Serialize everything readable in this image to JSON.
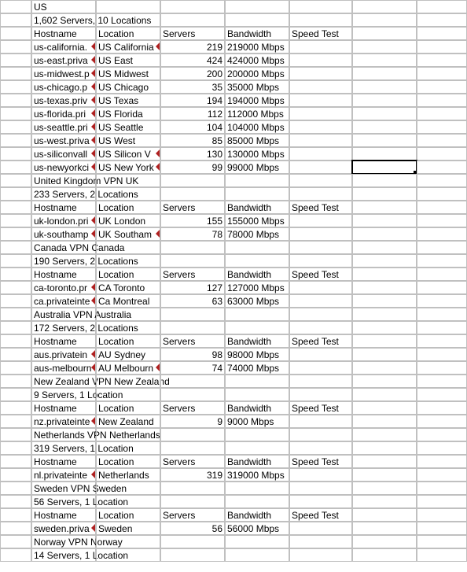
{
  "rows": [
    {
      "b": "US"
    },
    {
      "b": "1,602 Servers, 10 Locations",
      "span": true
    },
    {
      "b": "Hostname",
      "c": "Location",
      "d": "Servers",
      "dleft": true,
      "e": "Bandwidth",
      "f": "Speed Test"
    },
    {
      "b": "us-california.",
      "bof": true,
      "c": "US California",
      "cof": true,
      "d": "219",
      "e": "219000 Mbps"
    },
    {
      "b": "us-east.priva",
      "bof": true,
      "c": "US East",
      "d": "424",
      "e": "424000 Mbps"
    },
    {
      "b": "us-midwest.p",
      "bof": true,
      "c": "US Midwest",
      "d": "200",
      "e": "200000 Mbps"
    },
    {
      "b": "us-chicago.p",
      "bof": true,
      "c": "US Chicago",
      "d": "35",
      "e": "35000 Mbps"
    },
    {
      "b": "us-texas.priv",
      "bof": true,
      "c": "US Texas",
      "d": "194",
      "e": "194000 Mbps"
    },
    {
      "b": "us-florida.pri",
      "bof": true,
      "c": "US Florida",
      "d": "112",
      "e": "112000 Mbps"
    },
    {
      "b": "us-seattle.pri",
      "bof": true,
      "c": "US Seattle",
      "d": "104",
      "e": "104000 Mbps"
    },
    {
      "b": "us-west.priva",
      "bof": true,
      "c": "US West",
      "d": "85",
      "e": "85000 Mbps"
    },
    {
      "b": "us-siliconvall",
      "bof": true,
      "c": "US Silicon V",
      "cof": true,
      "d": "130",
      "e": "130000 Mbps"
    },
    {
      "b": "us-newyorkci",
      "bof": true,
      "c": "US New York",
      "cof": true,
      "d": "99",
      "e": "99000 Mbps",
      "sel": true
    },
    {
      "b": "United Kingdom VPN UK",
      "span": true
    },
    {
      "b": "233 Servers, 2 Locations",
      "span": true
    },
    {
      "b": "Hostname",
      "c": "Location",
      "d": "Servers",
      "dleft": true,
      "e": "Bandwidth",
      "f": "Speed Test"
    },
    {
      "b": "uk-london.pri",
      "bof": true,
      "c": "UK London",
      "d": "155",
      "e": "155000 Mbps"
    },
    {
      "b": "uk-southamp",
      "bof": true,
      "c": "UK Southam",
      "cof": true,
      "d": "78",
      "e": "78000 Mbps"
    },
    {
      "b": "Canada VPN Canada",
      "span": true
    },
    {
      "b": "190 Servers, 2 Locations",
      "span": true
    },
    {
      "b": "Hostname",
      "c": "Location",
      "d": "Servers",
      "dleft": true,
      "e": "Bandwidth",
      "f": "Speed Test"
    },
    {
      "b": "ca-toronto.pr",
      "bof": true,
      "c": "CA Toronto",
      "d": "127",
      "e": "127000 Mbps"
    },
    {
      "b": "ca.privateinte",
      "bof": true,
      "c": "Ca Montreal",
      "d": "63",
      "e": "63000 Mbps"
    },
    {
      "b": "Australia VPN Australia",
      "span": true
    },
    {
      "b": "172 Servers, 2 Locations",
      "span": true
    },
    {
      "b": "Hostname",
      "c": "Location",
      "d": "Servers",
      "dleft": true,
      "e": "Bandwidth",
      "f": "Speed Test"
    },
    {
      "b": "aus.privatein",
      "bof": true,
      "c": "AU Sydney",
      "d": "98",
      "e": "98000 Mbps"
    },
    {
      "b": "aus-melbourn",
      "bof": true,
      "c": "AU Melbourn",
      "cof": true,
      "d": "74",
      "e": "74000 Mbps"
    },
    {
      "b": "New Zealand VPN New Zealand",
      "span": true
    },
    {
      "b": "9 Servers, 1 Location",
      "span": true
    },
    {
      "b": "Hostname",
      "c": "Location",
      "d": "Servers",
      "dleft": true,
      "e": "Bandwidth",
      "f": "Speed Test"
    },
    {
      "b": "nz.privateinte",
      "bof": true,
      "c": "New Zealand",
      "d": "9",
      "e": "9000 Mbps"
    },
    {
      "b": "Netherlands VPN Netherlands",
      "span": true
    },
    {
      "b": "319 Servers, 1 Location",
      "span": true
    },
    {
      "b": "Hostname",
      "c": "Location",
      "d": "Servers",
      "dleft": true,
      "e": "Bandwidth",
      "f": "Speed Test"
    },
    {
      "b": "nl.privateinte",
      "bof": true,
      "c": "Netherlands",
      "d": "319",
      "e": "319000 Mbps"
    },
    {
      "b": "Sweden VPN Sweden",
      "span": true
    },
    {
      "b": "56 Servers, 1 Location",
      "span": true
    },
    {
      "b": "Hostname",
      "c": "Location",
      "d": "Servers",
      "dleft": true,
      "e": "Bandwidth",
      "f": "Speed Test"
    },
    {
      "b": "sweden.priva",
      "bof": true,
      "c": "Sweden",
      "d": "56",
      "e": "56000 Mbps"
    },
    {
      "b": "Norway VPN Norway",
      "span": true
    },
    {
      "b": "14 Servers, 1 Location",
      "span": true
    }
  ]
}
